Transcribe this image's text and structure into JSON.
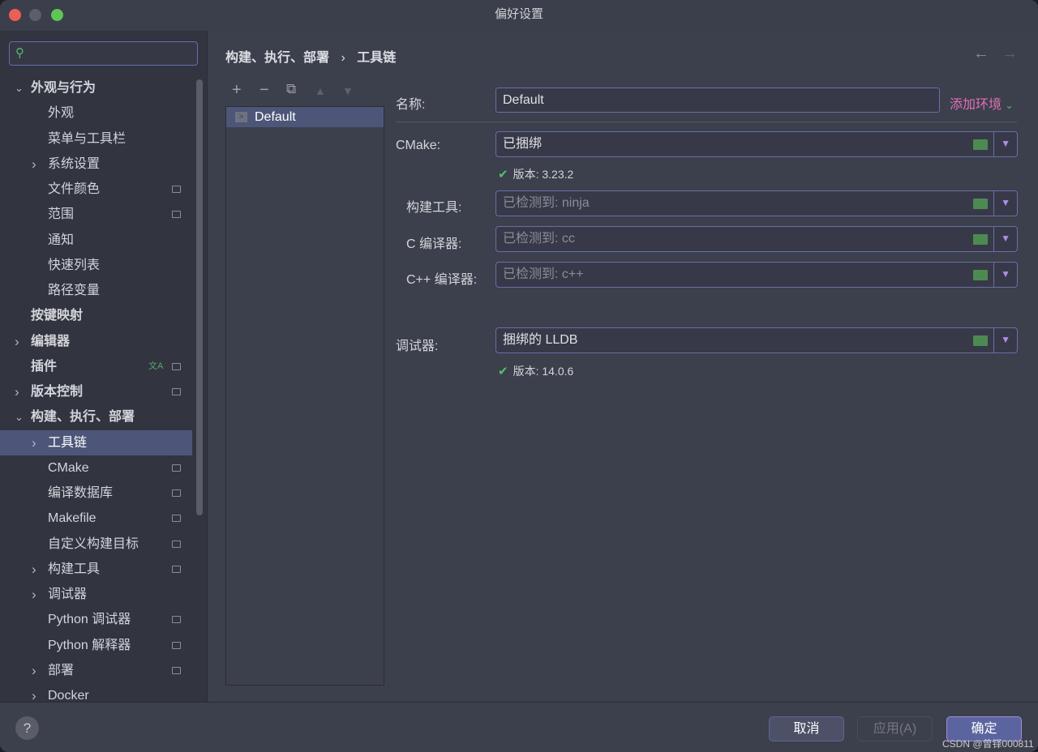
{
  "window": {
    "title": "偏好设置"
  },
  "sidebar": {
    "search_placeholder": "",
    "items": [
      {
        "label": "外观与行为",
        "level": 0,
        "chevron": "down",
        "bold": true
      },
      {
        "label": "外观",
        "level": 1
      },
      {
        "label": "菜单与工具栏",
        "level": 1
      },
      {
        "label": "系统设置",
        "level": 1,
        "chevron": "right"
      },
      {
        "label": "文件颜色",
        "level": 1,
        "icon": true
      },
      {
        "label": "范围",
        "level": 1,
        "icon": true
      },
      {
        "label": "通知",
        "level": 1
      },
      {
        "label": "快速列表",
        "level": 1
      },
      {
        "label": "路径变量",
        "level": 1
      },
      {
        "label": "按键映射",
        "level": 0,
        "bold": true
      },
      {
        "label": "编辑器",
        "level": 0,
        "chevron": "right",
        "bold": true
      },
      {
        "label": "插件",
        "level": 0,
        "bold": true,
        "icon": true,
        "translate": true
      },
      {
        "label": "版本控制",
        "level": 0,
        "chevron": "right",
        "bold": true,
        "icon": true
      },
      {
        "label": "构建、执行、部署",
        "level": 0,
        "chevron": "down",
        "bold": true
      },
      {
        "label": "工具链",
        "level": 1,
        "chevron": "right",
        "selected": true
      },
      {
        "label": "CMake",
        "level": 1,
        "icon": true
      },
      {
        "label": "编译数据库",
        "level": 1,
        "icon": true
      },
      {
        "label": "Makefile",
        "level": 1,
        "icon": true
      },
      {
        "label": "自定义构建目标",
        "level": 1,
        "icon": true
      },
      {
        "label": "构建工具",
        "level": 1,
        "chevron": "right",
        "icon": true
      },
      {
        "label": "调试器",
        "level": 1,
        "chevron": "right"
      },
      {
        "label": "Python 调试器",
        "level": 1,
        "icon": true
      },
      {
        "label": "Python 解释器",
        "level": 1,
        "icon": true
      },
      {
        "label": "部署",
        "level": 1,
        "chevron": "right",
        "icon": true
      },
      {
        "label": "Docker",
        "level": 1,
        "chevron": "right"
      }
    ]
  },
  "breadcrumb": {
    "parent": "构建、执行、部署",
    "sep": "›",
    "current": "工具链"
  },
  "toolchains": {
    "items": [
      "Default"
    ]
  },
  "form": {
    "name_label": "名称:",
    "name_value": "Default",
    "add_env": "添加环境",
    "cmake_label": "CMake:",
    "cmake_value": "已捆绑",
    "cmake_version": "版本: 3.23.2",
    "build_label": "构建工具:",
    "build_value": "已检测到: ninja",
    "c_label": "C 编译器:",
    "c_value": "已检测到: cc",
    "cpp_label": "C++ 编译器:",
    "cpp_value": "已检测到: c++",
    "debugger_label": "调试器:",
    "debugger_value": "捆绑的 LLDB",
    "debugger_version": "版本: 14.0.6"
  },
  "footer": {
    "help": "?",
    "cancel": "取消",
    "apply": "应用(A)",
    "ok": "确定",
    "watermark": "CSDN @曾铎000811"
  }
}
